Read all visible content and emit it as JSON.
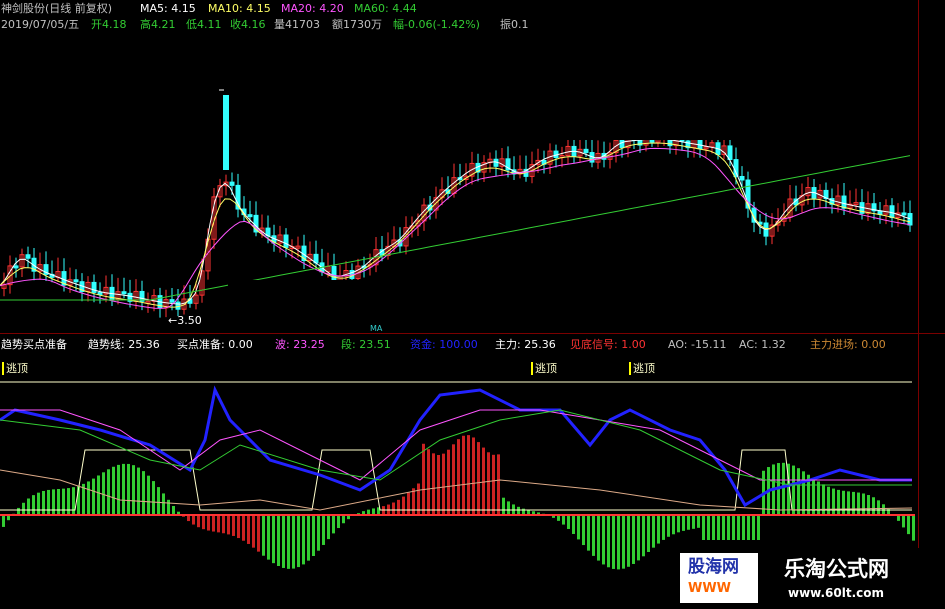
{
  "header": {
    "title": "神剑股份(日线 前复权)",
    "ma5": "MA5: 4.15",
    "ma10": "MA10: 4.15",
    "ma20": "MA20: 4.20",
    "ma60": "MA60: 4.44",
    "date": "2019/07/05/五",
    "open": "开4.18",
    "high": "高4.21",
    "low": "低4.11",
    "close": "收4.16",
    "vol": "量41703",
    "amount": "额1730万",
    "change": "幅-0.06(-1.42%)",
    "amp": "振0.1"
  },
  "price_panel": {
    "low_label": "3.50",
    "center_mark": "MA"
  },
  "indicator_bar": {
    "name": "趋势买点准备",
    "trend": "趋势线: 25.36",
    "buy_prep": "买点准备: 0.00",
    "wave": "波: 23.25",
    "segment": "段: 23.51",
    "blue_line": "资金: 100.00",
    "main": "主力: 25.36",
    "bottom_signal": "见底信号: 1.00",
    "ao": "AO: -15.11",
    "ac": "AC: 1.32",
    "main_entry": "主力进场: 0.00"
  },
  "escape_labels": [
    "逃顶",
    "逃顶",
    "逃顶"
  ],
  "watermark": {
    "left": "股海网",
    "left_sub": "WWW",
    "brand": "乐淘公式网",
    "url": "www.60lt.com"
  },
  "colors": {
    "up": "#ff3333",
    "down": "#33ffff",
    "ma5": "#ffffff",
    "ma10": "#ffff66",
    "ma20": "#ff55ff",
    "ma60": "#33cc33",
    "osc_blue": "#2222ff",
    "bar_green": "#33cc33",
    "bar_red": "#cc2222",
    "bar_orange": "#ff9900",
    "signal": "#ffffcc"
  }
}
